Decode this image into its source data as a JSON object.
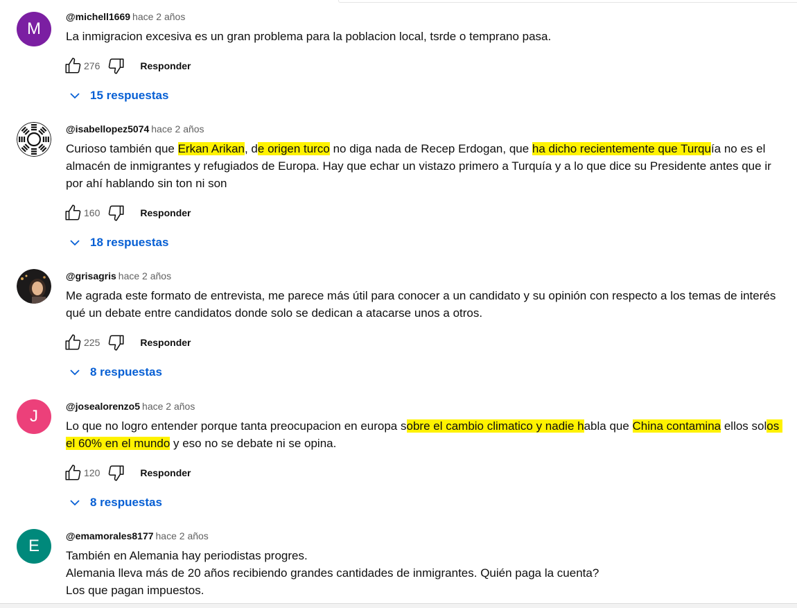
{
  "comments": [
    {
      "author": "@michell1669",
      "time": "hace 2 años",
      "avatar_letter": "M",
      "avatar_color": "#7b1fa2",
      "text": "La inmigracion excesiva es un gran problema para la poblacion local, tsrde o temprano pasa.",
      "likes": "276",
      "reply_label": "Responder",
      "replies_label": "15 respuestas"
    },
    {
      "author": "@isabellopez5074",
      "time": "hace 2 años",
      "avatar_letter": "",
      "avatar_icon": "bagua-symbol-icon",
      "text_parts": [
        {
          "t": "Curioso también que ",
          "h": false
        },
        {
          "t": "Erkan Arikan",
          "h": true
        },
        {
          "t": ", d",
          "h": false
        },
        {
          "t": "e origen turco",
          "h": true
        },
        {
          "t": " no diga nada de Recep Erdogan, que ",
          "h": false
        },
        {
          "t": "ha dicho recientemente que Turqu",
          "h": true
        },
        {
          "t": "ía no es el almacén de inmigrantes y refugiados de Europa. Hay que echar un vistazo primero a Turquía y a lo que dice su Presidente antes que ir por ahí hablando sin ton ni son",
          "h": false
        }
      ],
      "likes": "160",
      "reply_label": "Responder",
      "replies_label": "18 respuestas"
    },
    {
      "author": "@grisagris",
      "time": "hace 2 años",
      "avatar_icon": "user-photo-avatar",
      "text": "Me agrada este formato de entrevista, me parece más útil para conocer a un candidato y su opinión con respecto a los temas de interés qué un debate entre candidatos donde solo se dedican a atacarse unos a otros.",
      "likes": "225",
      "reply_label": "Responder",
      "replies_label": "8 respuestas"
    },
    {
      "author": "@josealorenzo5",
      "time": "hace 2 años",
      "avatar_letter": "J",
      "avatar_color": "#ec407a",
      "text_parts": [
        {
          "t": "Lo que no logro entender porque tanta preocupacion en europa s",
          "h": false
        },
        {
          "t": "obre el cambio climatico y nadie h",
          "h": true
        },
        {
          "t": "abla que ",
          "h": false
        },
        {
          "t": "China contamina",
          "h": true
        },
        {
          "t": " ellos sol",
          "h": false
        },
        {
          "t": "os el 60% en el mundo",
          "h": true
        },
        {
          "t": " y eso no se debate ni se opina.",
          "h": false
        }
      ],
      "likes": "120",
      "reply_label": "Responder",
      "replies_label": "8 respuestas"
    },
    {
      "author": "@emamorales8177",
      "time": "hace 2 años",
      "avatar_letter": "E",
      "avatar_color": "#00897b",
      "text": "También en Alemania hay periodistas progres.\nAlemania lleva más de 20 años recibiendo grandes cantidades de inmigrantes. Quién paga la cuenta?\nLos que pagan impuestos."
    }
  ]
}
